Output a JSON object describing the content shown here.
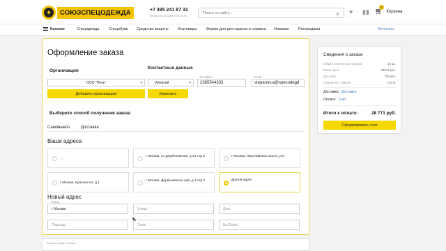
{
  "header": {
    "logo_text": "СОЮЗСПЕЦОДЕЖДА",
    "phone": "+7 495 241 87 33",
    "phone_note": "Звонки по Москве 8:00-20:00",
    "search_placeholder": "Поиск по сайту...",
    "cart_count": "0",
    "cart_label": "Корзина"
  },
  "nav": {
    "items": [
      "Каталог",
      "Спецодежда",
      "Спецобувь",
      "Средства защиты",
      "Хозтовары",
      "Форма для ресторанов и сервиса",
      "Новинки",
      "Распродажа",
      "Логотипы"
    ]
  },
  "order": {
    "title": "Оформление заказа",
    "organization_label": "Организация",
    "organization_value": "ООО \"Печь\"",
    "add_org_button": "Добавить организацию",
    "contacts_label": "Контактные данные",
    "contact_value": "Алексей",
    "change_button": "Изменить",
    "phone_label": "Телефон",
    "phone_value": "2365544333",
    "email_label": "Email",
    "email_value": "stepanov.a@specodegd",
    "delivery_title": "Выберите способ получения заказа",
    "tabs": [
      "Самовывоз",
      "Доставка"
    ],
    "addresses_title": "Ваши адреса",
    "addresses": [
      ", ,",
      "г Москва, ул Дербеневская, д 24 стр 3",
      "г Москва, Ярославское шоссе, д 5",
      "г Москва, Красная пл, д 1",
      "г Москва, Дербеневская наб, д 3 стр 2",
      "Другой адрес"
    ],
    "new_address_title": "Новый адрес",
    "fields": {
      "city_label": "Город",
      "city_value": "г Москва",
      "street": "Улица",
      "house": "Дом",
      "entrance": "Подъезд",
      "floor": "Этаж",
      "office": "Кв./Офис"
    },
    "comment_placeholder": "Комментарий к заказу"
  },
  "summary": {
    "title": "Сведения о заказе",
    "rows": [
      {
        "label": "Общее количество товаров",
        "value": "16 шт."
      },
      {
        "label": "Ваша цена",
        "value": "28071 руб."
      },
      {
        "label": "Доставка",
        "value": "700 руб."
      },
      {
        "label": "Общий вес товаров",
        "value": "7.00 кг."
      }
    ],
    "delivery_label": "Доставка:",
    "delivery_value": "Доставка",
    "payment_label": "Оплата:",
    "payment_value": "Счет",
    "total_label": "Итого к оплате:",
    "total_value": "28 771 руб.",
    "invoice_button": "Сформировать счет"
  }
}
